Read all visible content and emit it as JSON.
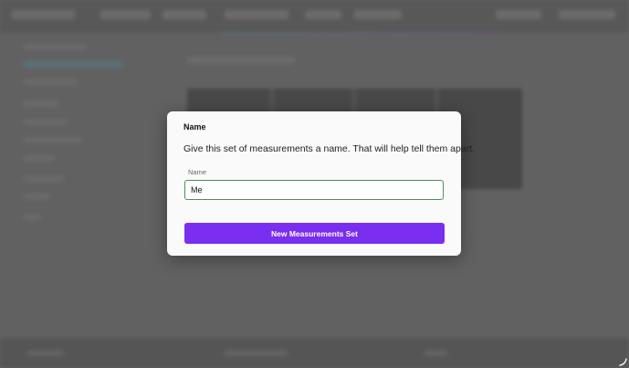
{
  "modal": {
    "title": "Name",
    "description": "Give this set of measurements a name. That will help tell them apart.",
    "field_label": "Name",
    "input_value": "Me",
    "submit_label": "New Measurements Set"
  },
  "colors": {
    "accent": "#7a2ff0",
    "input_focus_border": "#4e8f5b",
    "overlay": "#6a6a6a"
  },
  "icons": {
    "corner": "resize-grip-icon"
  }
}
